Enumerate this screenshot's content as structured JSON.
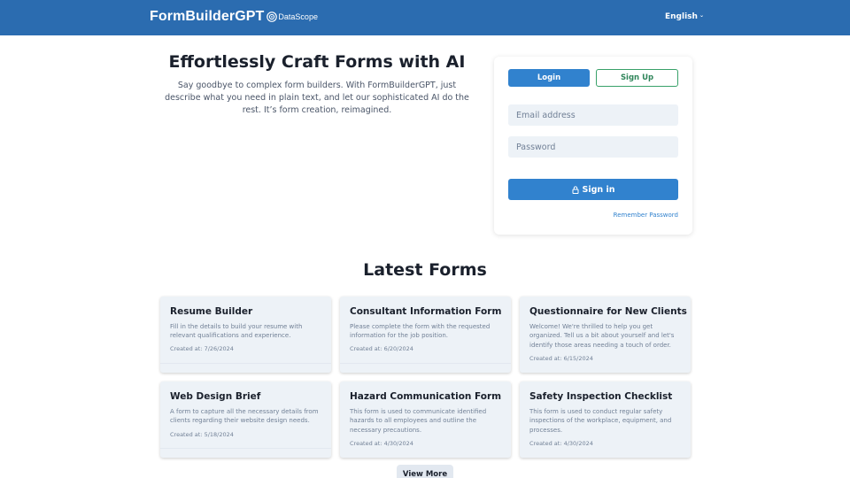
{
  "header": {
    "brand_name": "FormBuilderGPT",
    "brand_sub": "DataScope",
    "language": "English",
    "bg_color": "#2b6cb0"
  },
  "hero": {
    "title": "Effortlessly Craft Forms with AI",
    "description": "Say goodbye to complex form builders. With FormBuilderGPT, just describe what you need in plain text, and let our sophisticated AI do the rest. It’s form creation, reimagined."
  },
  "auth": {
    "login_tab": "Login",
    "signup_tab": "Sign Up",
    "email_placeholder": "Email address",
    "password_placeholder": "Password",
    "signin_label": "Sign in",
    "remember_label": "Remember Password",
    "accent": "#3182ce",
    "signup_color": "#38a169"
  },
  "latest": {
    "title": "Latest Forms",
    "view_more": "View More",
    "forms": [
      {
        "title": "Resume Builder",
        "description": "Fill in the details to build your resume with relevant qualifications and experience.",
        "created": "Created at: 7/26/2024"
      },
      {
        "title": "Consultant Information Form",
        "description": "Please complete the form with the requested information for the job position.",
        "created": "Created at: 6/20/2024"
      },
      {
        "title": "Questionnaire for New Clients",
        "description": "Welcome! We're thrilled to help you get organized. Tell us a bit about yourself and let's identify those areas needing a touch of order.",
        "created": "Created at: 6/15/2024"
      },
      {
        "title": "Web Design Brief",
        "description": "A form to capture all the necessary details from clients regarding their website design needs.",
        "created": "Created at: 5/18/2024"
      },
      {
        "title": "Hazard Communication Form",
        "description": "This form is used to communicate identified hazards to all employees and outline the necessary precautions.",
        "created": "Created at: 4/30/2024"
      },
      {
        "title": "Safety Inspection Checklist",
        "description": "This form is used to conduct regular safety inspections of the workplace, equipment, and processes.",
        "created": "Created at: 4/30/2024"
      }
    ]
  }
}
